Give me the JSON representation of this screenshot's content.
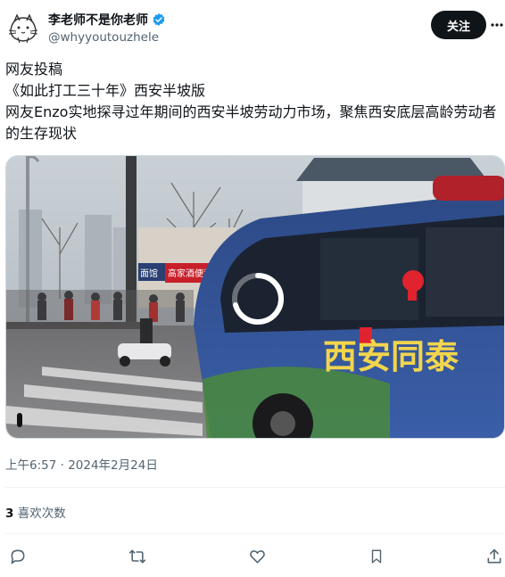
{
  "author": {
    "display_name": "李老师不是你老师",
    "handle": "@whyyoutouzhele",
    "verified_color": "#1d9bf0"
  },
  "follow_button": {
    "label": "关注"
  },
  "tweet": {
    "lines": [
      "网友投稿",
      "《如此打工三十年》西安半坡版",
      "网友Enzo实地探寻过年期间的西安半坡劳动力市场，聚焦西安底层高龄劳动者的生存现状"
    ]
  },
  "media": {
    "type": "video",
    "state": "loading",
    "bus_sign_text": "西安同泰",
    "shop_sign_1": "面馆",
    "shop_sign_2": "高家酒便利店"
  },
  "timestamp": "上午6:57 · 2024年2月24日",
  "stats": {
    "likes_count": "3",
    "likes_label": "喜欢次数"
  },
  "actions": [
    "reply-icon",
    "retweet-icon",
    "like-icon",
    "bookmark-icon",
    "share-icon"
  ],
  "colors": {
    "text": "#0f1419",
    "secondary": "#536471",
    "follow_bg": "#0f1419",
    "divider": "#eff3f4"
  }
}
